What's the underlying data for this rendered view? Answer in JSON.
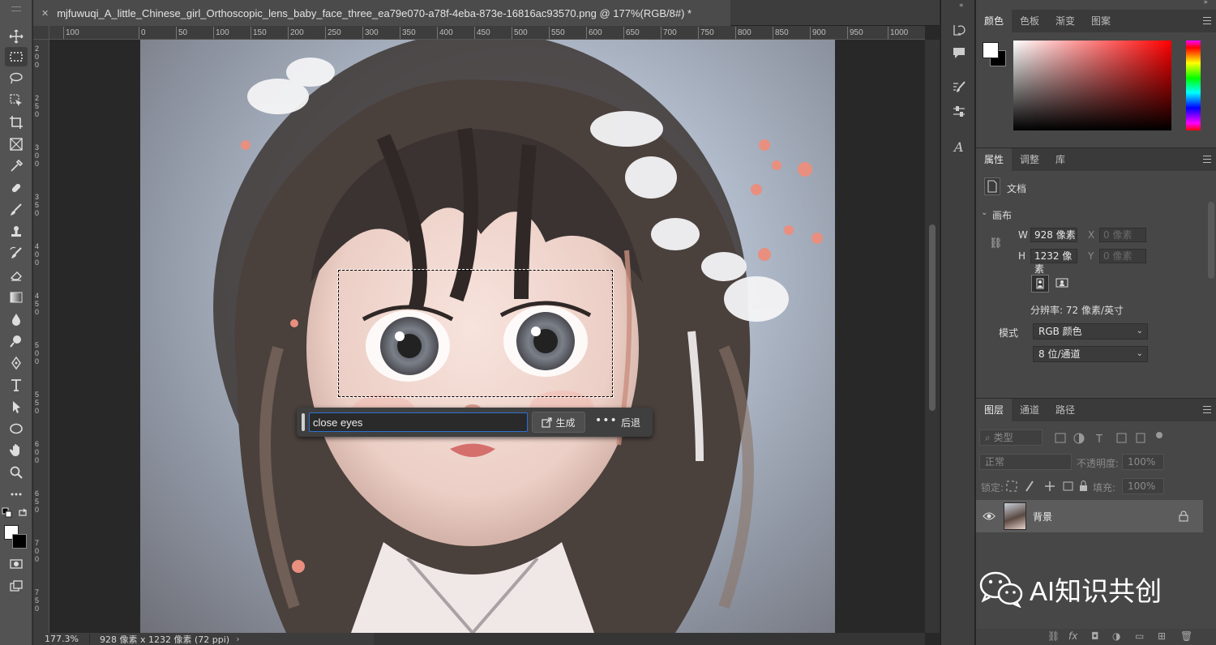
{
  "document": {
    "tab_title": "mjfuwuqi_A_little_Chinese_girl_Orthoscopic_lens_baby_face_three_ea79e070-a78f-4eba-873e-16816ac93570.png @ 177%(RGB/8#) *",
    "close_glyph": "✕"
  },
  "ruler": {
    "top_ticks": [
      "100",
      "0",
      "50",
      "100",
      "150",
      "200",
      "250",
      "300",
      "350",
      "400",
      "450",
      "500",
      "550",
      "600",
      "650",
      "700",
      "750",
      "800",
      "850",
      "900",
      "950",
      "1000"
    ],
    "left_ticks": [
      "200",
      "250",
      "300",
      "350",
      "400",
      "450",
      "500",
      "550",
      "600",
      "650",
      "700",
      "750"
    ]
  },
  "generative_fill": {
    "prompt_value": "close eyes",
    "generate_label": "生成",
    "more_label": "•••",
    "back_label": "后退"
  },
  "status": {
    "zoom": "177.3%",
    "info": "928 像素 x 1232 像素 (72 ppi)",
    "arrow": "›"
  },
  "color_panel": {
    "tabs": [
      "颜色",
      "色板",
      "渐变",
      "图案"
    ],
    "foreground": "#ffffff",
    "background": "#000000"
  },
  "properties_panel": {
    "tabs": [
      "属性",
      "调整",
      "库"
    ],
    "doc_label": "文档",
    "canvas_section": "画布",
    "w_label": "W",
    "w_value": "928 像素",
    "h_label": "H",
    "h_value": "1232 像素",
    "x_label": "X",
    "x_placeholder": "0 像素",
    "y_label": "Y",
    "y_placeholder": "0 像素",
    "resolution": "分辨率: 72 像素/英寸",
    "mode_label": "模式",
    "mode_value": "RGB 颜色",
    "depth_value": "8 位/通道"
  },
  "layers_panel": {
    "tabs": [
      "图层",
      "通道",
      "路径"
    ],
    "filter_kind": "类型",
    "blend_mode": "正常",
    "opacity_label": "不透明度:",
    "opacity_value": "100%",
    "lock_label": "锁定:",
    "fill_label": "填充:",
    "fill_value": "100%",
    "layer_name": "背景"
  },
  "watermark": {
    "text": "AI知识共创"
  },
  "colors": {
    "accent_blue": "#2d6fd2",
    "panel_bg": "#474747",
    "toolbar_bg": "#535353"
  }
}
